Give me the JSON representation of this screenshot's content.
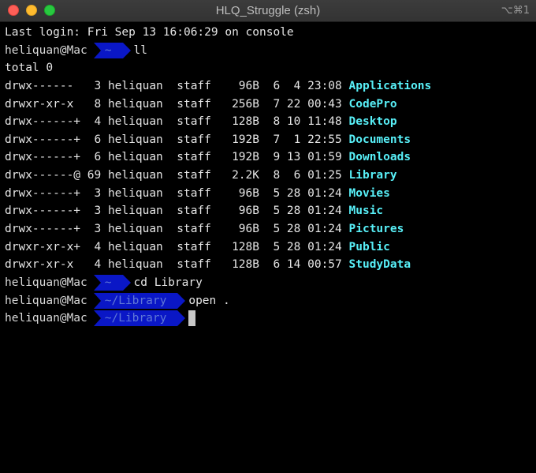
{
  "window": {
    "title": "HLQ_Struggle (zsh)",
    "shortcut": "⌥⌘1",
    "colors": {
      "background": "#000000",
      "directory": "#58f0f8",
      "prompt_segment": "#0a17c6"
    }
  },
  "terminal": {
    "last_login": "Last login: Fri Sep 13 16:06:29 on console",
    "prompt1": {
      "user": "heliquan@Mac",
      "path": "~",
      "command": "ll"
    },
    "total": "total 0",
    "listing": [
      {
        "meta": "drwx------   3 heliquan  staff    96B  6  4 23:08 ",
        "name": "Applications"
      },
      {
        "meta": "drwxr-xr-x   8 heliquan  staff   256B  7 22 00:43 ",
        "name": "CodePro"
      },
      {
        "meta": "drwx------+  4 heliquan  staff   128B  8 10 11:48 ",
        "name": "Desktop"
      },
      {
        "meta": "drwx------+  6 heliquan  staff   192B  7  1 22:55 ",
        "name": "Documents"
      },
      {
        "meta": "drwx------+  6 heliquan  staff   192B  9 13 01:59 ",
        "name": "Downloads"
      },
      {
        "meta": "drwx------@ 69 heliquan  staff   2.2K  8  6 01:25 ",
        "name": "Library"
      },
      {
        "meta": "drwx------+  3 heliquan  staff    96B  5 28 01:24 ",
        "name": "Movies"
      },
      {
        "meta": "drwx------+  3 heliquan  staff    96B  5 28 01:24 ",
        "name": "Music"
      },
      {
        "meta": "drwx------+  3 heliquan  staff    96B  5 28 01:24 ",
        "name": "Pictures"
      },
      {
        "meta": "drwxr-xr-x+  4 heliquan  staff   128B  5 28 01:24 ",
        "name": "Public"
      },
      {
        "meta": "drwxr-xr-x   4 heliquan  staff   128B  6 14 00:57 ",
        "name": "StudyData"
      }
    ],
    "prompt2": {
      "user": "heliquan@Mac",
      "path": "~",
      "command": "cd Library"
    },
    "prompt3": {
      "user": "heliquan@Mac",
      "path": "~/Library",
      "command": "open ."
    },
    "prompt4": {
      "user": "heliquan@Mac",
      "path": "~/Library",
      "command": ""
    }
  }
}
